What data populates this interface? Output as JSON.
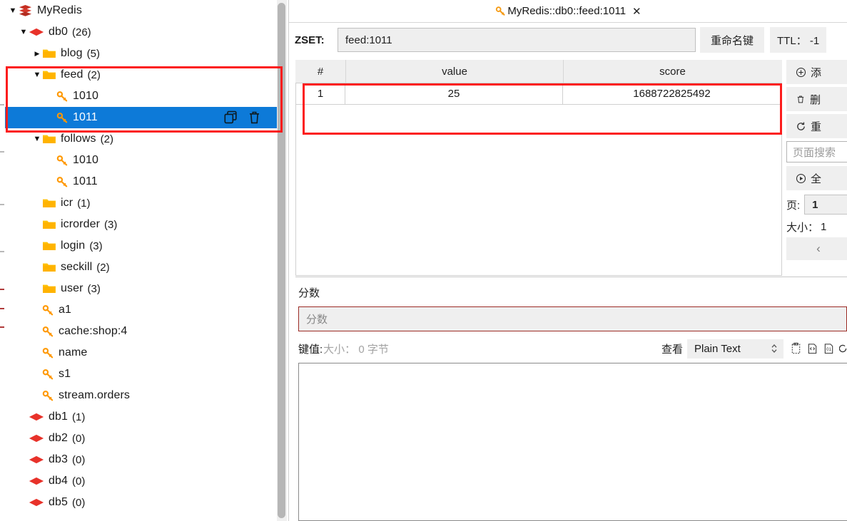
{
  "app": {
    "title": "MyRedis"
  },
  "sidebar": {
    "nodes": [
      {
        "label": "MyRedis",
        "count": "",
        "icon": "stack-icon",
        "level": 0,
        "expander": "down",
        "selected": false
      },
      {
        "label": "db0",
        "count": "(26)",
        "icon": "db-icon",
        "level": 1,
        "expander": "down",
        "selected": false
      },
      {
        "label": "blog",
        "count": "(5)",
        "icon": "folder-icon",
        "level": 2,
        "expander": "right",
        "selected": false
      },
      {
        "label": "feed",
        "count": "(2)",
        "icon": "folder-icon",
        "level": 2,
        "expander": "down",
        "selected": false
      },
      {
        "label": "1010",
        "count": "",
        "icon": "key-icon",
        "level": 3,
        "expander": "none",
        "selected": false
      },
      {
        "label": "1011",
        "count": "",
        "icon": "key-icon",
        "level": 3,
        "expander": "none",
        "selected": true
      },
      {
        "label": "follows",
        "count": "(2)",
        "icon": "folder-icon",
        "level": 2,
        "expander": "down",
        "selected": false
      },
      {
        "label": "1010",
        "count": "",
        "icon": "key-icon",
        "level": 3,
        "expander": "none",
        "selected": false
      },
      {
        "label": "1011",
        "count": "",
        "icon": "key-icon",
        "level": 3,
        "expander": "none",
        "selected": false
      },
      {
        "label": "icr",
        "count": "(1)",
        "icon": "folder-icon",
        "level": 2,
        "expander": "none",
        "selected": false
      },
      {
        "label": "icrorder",
        "count": "(3)",
        "icon": "folder-icon",
        "level": 2,
        "expander": "none",
        "selected": false
      },
      {
        "label": "login",
        "count": "(3)",
        "icon": "folder-icon",
        "level": 2,
        "expander": "none",
        "selected": false
      },
      {
        "label": "seckill",
        "count": "(2)",
        "icon": "folder-icon",
        "level": 2,
        "expander": "none",
        "selected": false
      },
      {
        "label": "user",
        "count": "(3)",
        "icon": "folder-icon",
        "level": 2,
        "expander": "none",
        "selected": false
      },
      {
        "label": "a1",
        "count": "",
        "icon": "key-icon",
        "level": 2,
        "expander": "none",
        "selected": false
      },
      {
        "label": "cache:shop:4",
        "count": "",
        "icon": "key-icon",
        "level": 2,
        "expander": "none",
        "selected": false
      },
      {
        "label": "name",
        "count": "",
        "icon": "key-icon",
        "level": 2,
        "expander": "none",
        "selected": false
      },
      {
        "label": "s1",
        "count": "",
        "icon": "key-icon",
        "level": 2,
        "expander": "none",
        "selected": false
      },
      {
        "label": "stream.orders",
        "count": "",
        "icon": "key-icon",
        "level": 2,
        "expander": "none",
        "selected": false
      },
      {
        "label": "db1",
        "count": "(1)",
        "icon": "db-icon",
        "level": 1,
        "expander": "none",
        "selected": false
      },
      {
        "label": "db2",
        "count": "(0)",
        "icon": "db-icon",
        "level": 1,
        "expander": "none",
        "selected": false
      },
      {
        "label": "db3",
        "count": "(0)",
        "icon": "db-icon",
        "level": 1,
        "expander": "none",
        "selected": false
      },
      {
        "label": "db4",
        "count": "(0)",
        "icon": "db-icon",
        "level": 1,
        "expander": "none",
        "selected": false
      },
      {
        "label": "db5",
        "count": "(0)",
        "icon": "db-icon",
        "level": 1,
        "expander": "none",
        "selected": false
      }
    ],
    "row_actions": {
      "copy": "copy-key-icon",
      "delete": "delete-key-icon"
    }
  },
  "tab": {
    "label": "MyRedis::db0::feed:1011",
    "close": "✕",
    "icon": "key-icon"
  },
  "key_header": {
    "type_label": "ZSET:",
    "key_value": "feed:1011",
    "rename_button": "重命名键",
    "ttl_label": "TTL： -1"
  },
  "table": {
    "columns": [
      "#",
      "value",
      "score"
    ],
    "rows": [
      {
        "index": "1",
        "value": "25",
        "score": "1688722825492"
      }
    ]
  },
  "actions": {
    "add": "添",
    "delete": "删",
    "reload": "重",
    "search_placeholder": "页面搜索",
    "scan_all": "全",
    "page_label": "页:",
    "page_value": "1",
    "size_label": "大小：",
    "size_value": "1",
    "prev": "‹"
  },
  "score_section": {
    "label": "分数",
    "placeholder": "分数"
  },
  "value_section": {
    "key_label": "键值:",
    "size_text": "大小： 0 字节",
    "view_label": "查看",
    "view_mode": "Plain Text",
    "value_text": ""
  },
  "colors": {
    "selection": "#0d7ad8",
    "annotation": "#fc1c1c",
    "folder": "#ffb300",
    "key": "#ff9800",
    "db": "#e8322a",
    "panel": "#efefef"
  }
}
